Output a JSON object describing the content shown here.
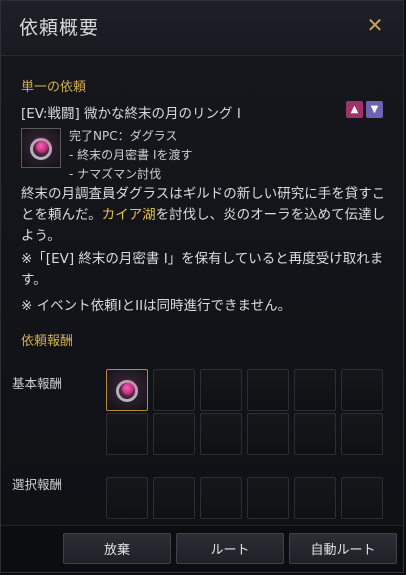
{
  "window": {
    "title": "依頼概要",
    "close_icon": "close-icon"
  },
  "quest": {
    "type_label": "単一の依頼",
    "title": "[EV:戦闘] 微かな終末の月のリング I",
    "npc_lines": [
      "完了NPC：ダグラス",
      "- 終末の月密書 Iを渡す",
      "- ナマズマン討伐"
    ],
    "description_before": "終末の月調査員ダグラスはギルドの新しい研究に手を貸すことを頼んだ。",
    "description_highlight": "カイア湖",
    "description_after": "を討伐し、炎のオーラを込めて伝達しよう。",
    "note1": "※「[EV] 終末の月密書 I」を保有していると再度受け取れます。",
    "note2": "※ イベント依頼IとIIは同時進行できません。"
  },
  "rewards": {
    "section_label": "依頼報酬",
    "basic_label": "基本報酬",
    "select_label": "選択報酬"
  },
  "buttons": {
    "abandon": "放棄",
    "route": "ルート",
    "auto_route": "自動ルート"
  },
  "colors": {
    "accent": "#d3ad52",
    "highlight": "#e6c24a",
    "up_arrow": "#a0326a",
    "down_arrow": "#6e62b5"
  }
}
